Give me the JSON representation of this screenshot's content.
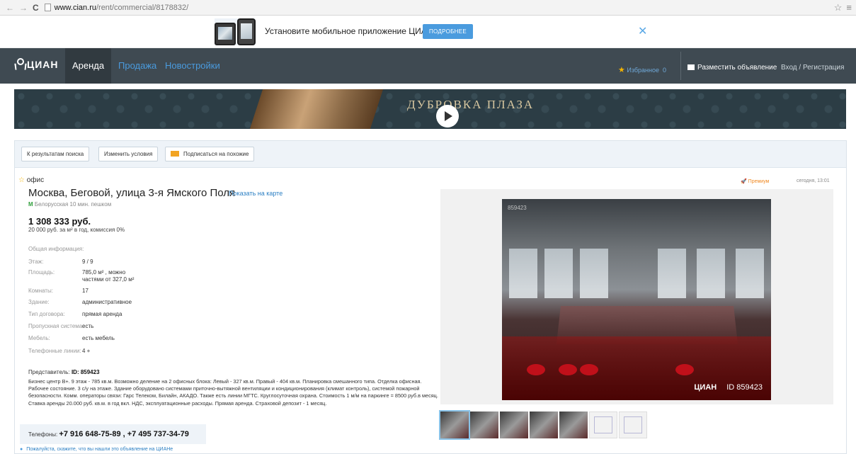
{
  "browser": {
    "back": "←",
    "forward": "→",
    "reload": "C",
    "url_host": "www.cian.ru",
    "url_path": "/rent/commercial/8178832/",
    "star": "☆",
    "menu": "≡"
  },
  "app_banner": {
    "text": "Установите мобильное приложение ЦИАН",
    "button": "ПОДРОБНЕЕ",
    "close": "✕"
  },
  "nav": {
    "logo": "ЦИАН",
    "tabs": [
      "Аренда",
      "Продажа",
      "Новостройки"
    ],
    "favorites": "Избранное",
    "favorites_count": "0",
    "post_ad": "Разместить объявление",
    "login": "Вход / Регистрация"
  },
  "ad": {
    "brand": "ДУБРОВКА ПЛАЗА"
  },
  "toolbar": {
    "back": "К результатам поиска",
    "change": "Изменить условия",
    "subscribe": "Подписаться на похожие"
  },
  "listing": {
    "type": "офис",
    "title": "Москва, Беговой, улица 3-я Ямского Поля",
    "map_link": "Показать на карте",
    "metro_icon": "М",
    "metro": "Белорусская 10 мин. пешком",
    "price": "1 308 333 руб.",
    "price_sub": "20 000 руб. за м² в год, комиссия 0%",
    "premium": "Премиум",
    "date": "сегодня, 13:01",
    "general_info": "Общая информация:",
    "specs": [
      {
        "key": "Этаж:",
        "value": "9 / 9"
      },
      {
        "key": "Площадь:",
        "value": "785,0 м² , можно"
      },
      {
        "key": "",
        "value": "частями от 327,0 м²"
      },
      {
        "key": "Комнаты:",
        "value": "17"
      },
      {
        "key": "Здание:",
        "value": "административное"
      },
      {
        "key": "Тип договора:",
        "value": "прямая аренда"
      },
      {
        "key": "Пропускная система:",
        "value": "есть"
      },
      {
        "key": "Мебель:",
        "value": "есть мебель"
      },
      {
        "key": "Телефонные линии:",
        "value": "4 +"
      }
    ],
    "rep_label": "Представитель:",
    "rep_id": "ID: 859423",
    "description": "Бизнес центр В+. 9 этаж - 785 кв.м. Возможно деление на 2 офисных блока: Левый - 327 кв.м. Правый - 404 кв.м. Планировка смешанного типа. Отделка офисная. Рабочее состояние. 3 с/у на этаже. Здание оборудовано системами приточно-вытяжной вентиляции и кондиционирования (климат контроль), системой пожарной безопасности. Комм. операторы связи: Гарс Телеком, Билайн, АКАДО. Также есть линии МГТС. Круглосуточная охрана. Стоимость 1 м/м на паркинге = 8500 руб.в месяц. Ставка аренды 20.000 руб. кв.м. в год вкл. НДС, эксплуатационные расходы. Прямая аренда. Страховой депозит - 1 месяц.",
    "phones_label": "Телефоны:",
    "phones": "+7 916 648-75-89 , +7 495 737-34-79",
    "tip": "Пожалуйста, скажите, что вы нашли это объявление на ЦИАНе"
  },
  "photo": {
    "id_tag": "859423",
    "watermark": "ЦИАН",
    "watermark_id": "ID 859423",
    "thumbnail_count": 7
  }
}
